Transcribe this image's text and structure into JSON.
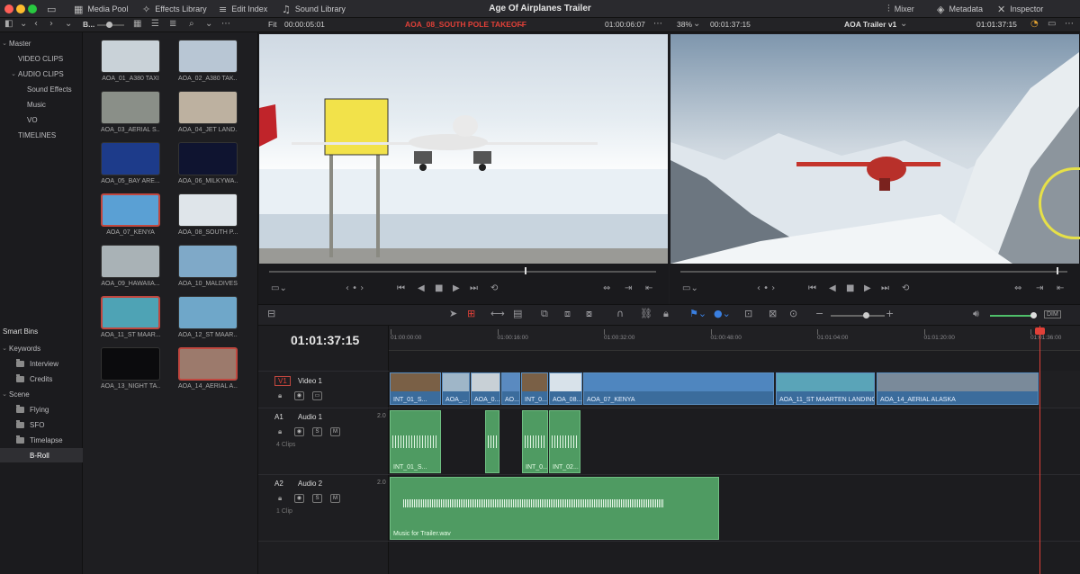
{
  "window": {
    "title": "Age Of Airplanes Trailer",
    "dots": [
      "#ff5f57",
      "#febc2e",
      "#28c840"
    ]
  },
  "topbar": {
    "media_pool": "Media Pool",
    "effects_library": "Effects Library",
    "edit_index": "Edit Index",
    "sound_library": "Sound Library",
    "mixer": "Mixer",
    "metadata": "Metadata",
    "inspector": "Inspector"
  },
  "subbar": {
    "bin_label": "B...",
    "fit": "Fit",
    "source_tc": "00:00:05:01",
    "source_clip": "AOA_08_SOUTH POLE TAKEOFF",
    "source_duration": "01:00:06:07",
    "zoom": "38%",
    "timeline_tc": "00:01:37:15",
    "timeline_name": "AOA Trailer v1",
    "record_tc": "01:01:37:15"
  },
  "bins": {
    "items": [
      {
        "label": "Master",
        "chev": "⌄",
        "indent": 0
      },
      {
        "label": "VIDEO CLIPS",
        "chev": "",
        "indent": 1
      },
      {
        "label": "AUDIO CLIPS",
        "chev": "⌄",
        "indent": 1
      },
      {
        "label": "Sound Effects",
        "chev": "",
        "indent": 2
      },
      {
        "label": "Music",
        "chev": "",
        "indent": 2
      },
      {
        "label": "VO",
        "chev": "",
        "indent": 2
      },
      {
        "label": "TIMELINES",
        "chev": "",
        "indent": 1
      }
    ],
    "smart_bins_title": "Smart Bins",
    "smart": [
      {
        "label": "Keywords",
        "chev": "⌄",
        "folder": false,
        "indent": 0
      },
      {
        "label": "Interview",
        "chev": "",
        "folder": true,
        "indent": 1
      },
      {
        "label": "Credits",
        "chev": "",
        "folder": true,
        "indent": 1
      },
      {
        "label": "Scene",
        "chev": "⌄",
        "folder": false,
        "indent": 0
      },
      {
        "label": "Flying",
        "chev": "",
        "folder": true,
        "indent": 1
      },
      {
        "label": "SFO",
        "chev": "",
        "folder": true,
        "indent": 1
      },
      {
        "label": "Timelapse",
        "chev": "",
        "folder": true,
        "indent": 1
      },
      {
        "label": "B-Roll",
        "chev": "",
        "folder": false,
        "indent": 1,
        "selected": true
      }
    ]
  },
  "clips": [
    {
      "label": "AOA_01_A380 TAXI",
      "color": "#c9d2d8",
      "selected": false
    },
    {
      "label": "AOA_02_A380 TAK...",
      "color": "#b8c6d4",
      "selected": false
    },
    {
      "label": "AOA_03_AERIAL S...",
      "color": "#8a8f88",
      "selected": false
    },
    {
      "label": "AOA_04_JET LAND...",
      "color": "#bdb1a0",
      "selected": false
    },
    {
      "label": "AOA_05_BAY ARE...",
      "color": "#1d3b8a",
      "selected": false
    },
    {
      "label": "AOA_06_MILKYWA...",
      "color": "#0f1430",
      "selected": false
    },
    {
      "label": "AOA_07_KENYA",
      "color": "#5aa0d4",
      "selected": true
    },
    {
      "label": "AOA_08_SOUTH P...",
      "color": "#dfe5ea",
      "selected": false
    },
    {
      "label": "AOA_09_HAWAIIA...",
      "color": "#a9b2b6",
      "selected": false
    },
    {
      "label": "AOA_10_MALDIVES",
      "color": "#7fa9c8",
      "selected": false
    },
    {
      "label": "AOA_11_ST MAAR...",
      "color": "#4ea3b5",
      "selected": true
    },
    {
      "label": "AOA_12_ST MAAR...",
      "color": "#6fa7c9",
      "selected": false
    },
    {
      "label": "AOA_13_NIGHT TA...",
      "color": "#0b0b0d",
      "selected": false
    },
    {
      "label": "AOA_14_AERIAL A...",
      "color": "#9c7a6c",
      "selected": true
    }
  ],
  "timeline": {
    "timecode": "01:01:37:15",
    "ruler": [
      "01:00:00:00",
      "01:00:16:00",
      "01:00:32:00",
      "01:00:48:00",
      "01:01:04:00",
      "01:01:20:00",
      "01:01:36:00"
    ],
    "tracks": {
      "v1": {
        "id": "V1",
        "name": "Video 1"
      },
      "a1": {
        "id": "A1",
        "name": "Audio 1",
        "level": "2.0",
        "count": "4 Clips"
      },
      "a2": {
        "id": "A2",
        "name": "Audio 2",
        "level": "2.0",
        "count": "1 Clip"
      }
    },
    "video_clips": [
      "INT_01_S...",
      "AOA_...",
      "AOA_0...",
      "AO...",
      "INT_0...",
      "AOA_08...",
      "AOA_07_KENYA",
      "AOA_11_ST MAARTEN LANDING",
      "AOA_14_AERIAL ALASKA"
    ],
    "audio1_clips": [
      "INT_01_S...",
      "",
      "INT_0...",
      "INT_02..."
    ],
    "audio2_clip": "Music for Trailer.wav",
    "track_buttons": {
      "solo": "S",
      "mute": "M"
    }
  },
  "colors": {
    "accent_red": "#e04038",
    "video_clip": "#3b6c9c",
    "audio_clip": "#4f9b62"
  }
}
